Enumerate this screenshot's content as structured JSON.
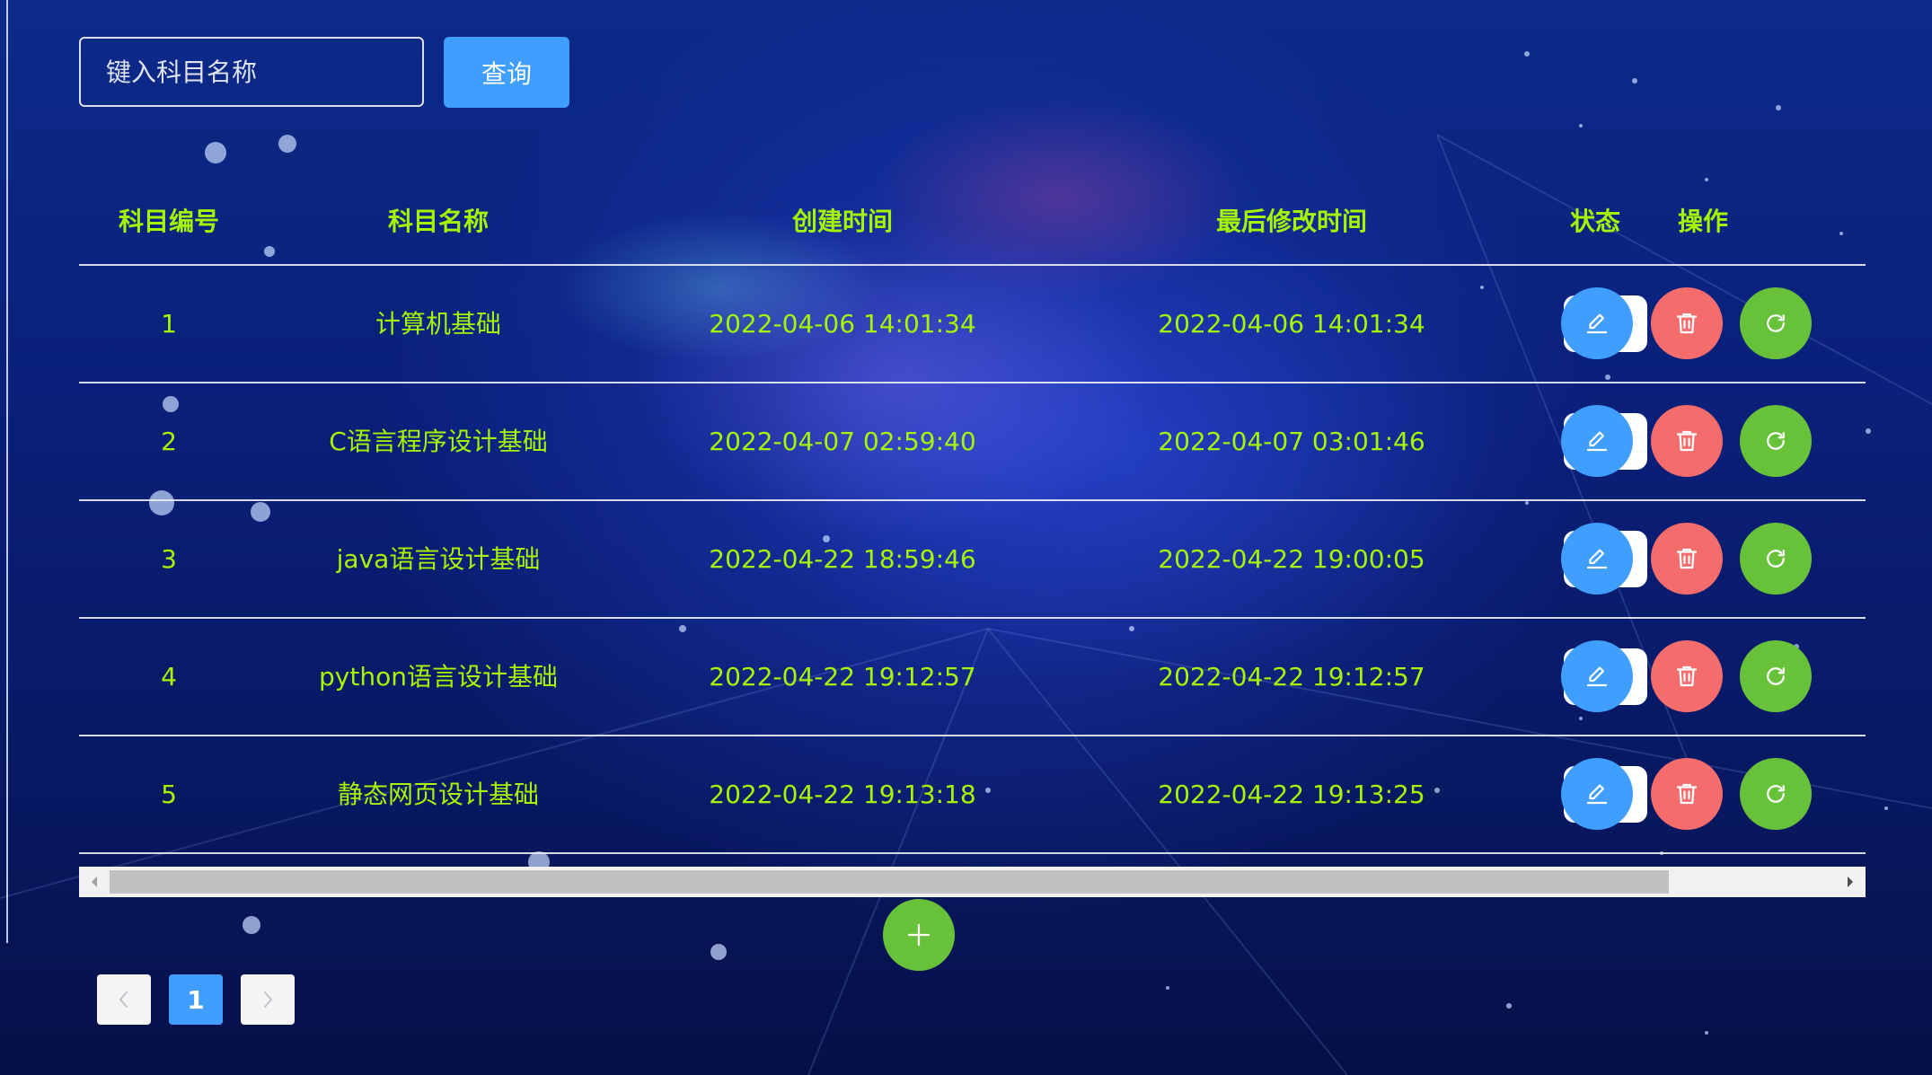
{
  "search": {
    "placeholder": "键入科目名称",
    "button_label": "查询"
  },
  "table": {
    "headers": {
      "id": "科目编号",
      "name": "科目名称",
      "created": "创建时间",
      "modified": "最后修改时间",
      "status": "状态",
      "operations": "操作"
    },
    "rows": [
      {
        "id": "1",
        "name": "计算机基础",
        "created": "2022-04-06 14:01:34",
        "modified": "2022-04-06 14:01:34"
      },
      {
        "id": "2",
        "name": "C语言程序设计基础",
        "created": "2022-04-07 02:59:40",
        "modified": "2022-04-07 03:01:46"
      },
      {
        "id": "3",
        "name": "java语言设计基础",
        "created": "2022-04-22 18:59:46",
        "modified": "2022-04-22 19:00:05"
      },
      {
        "id": "4",
        "name": "python语言设计基础",
        "created": "2022-04-22 19:12:57",
        "modified": "2022-04-22 19:12:57"
      },
      {
        "id": "5",
        "name": "静态网页设计基础",
        "created": "2022-04-22 19:13:18",
        "modified": "2022-04-22 19:13:25"
      }
    ]
  },
  "pagination": {
    "current_page": "1"
  },
  "colors": {
    "text_accent": "#a6f500",
    "primary": "#409eff",
    "danger": "#f56c6c",
    "success": "#67c23a"
  },
  "icons": {
    "edit": "edit-icon",
    "delete": "delete-icon",
    "reset": "refresh-icon",
    "add": "plus-icon",
    "prev": "chevron-left-icon",
    "next": "chevron-right-icon"
  }
}
